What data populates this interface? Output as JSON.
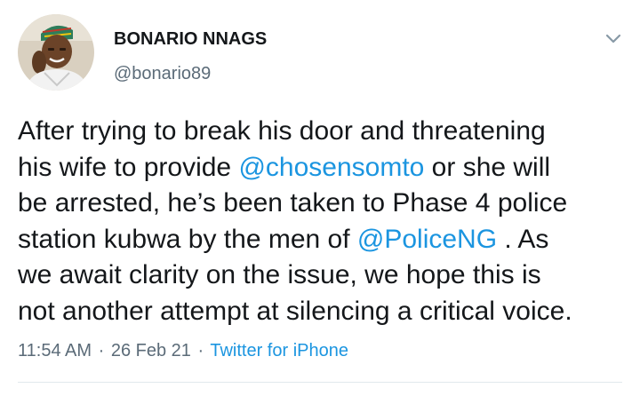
{
  "author": {
    "name": "BONARIO NNAGS",
    "handle": "@bonario89"
  },
  "tweet": {
    "lines": [
      {
        "before": "After trying to break his door and threatening",
        "mention": "",
        "after": ""
      },
      {
        "before": "his wife to provide ",
        "mention": "@chosensomto",
        "after": " or she will"
      },
      {
        "before": "be arrested, he’s been taken to Phase 4 police",
        "mention": "",
        "after": ""
      },
      {
        "before": "station kubwa by the men of ",
        "mention": "@PoliceNG",
        "after": " . As"
      },
      {
        "before": "we  await clarity on the issue, we hope this is",
        "mention": "",
        "after": ""
      },
      {
        "before": "not another attempt at silencing a critical voice.",
        "mention": "",
        "after": ""
      }
    ]
  },
  "meta": {
    "time": "11:54 AM",
    "date": "26 Feb 21",
    "source": "Twitter for iPhone",
    "separator": "·"
  },
  "colors": {
    "link": "#1b95e0",
    "secondary_text": "#5b6b78",
    "primary_text": "#14171a"
  },
  "icons": {
    "menu": "chevron-down-icon"
  }
}
